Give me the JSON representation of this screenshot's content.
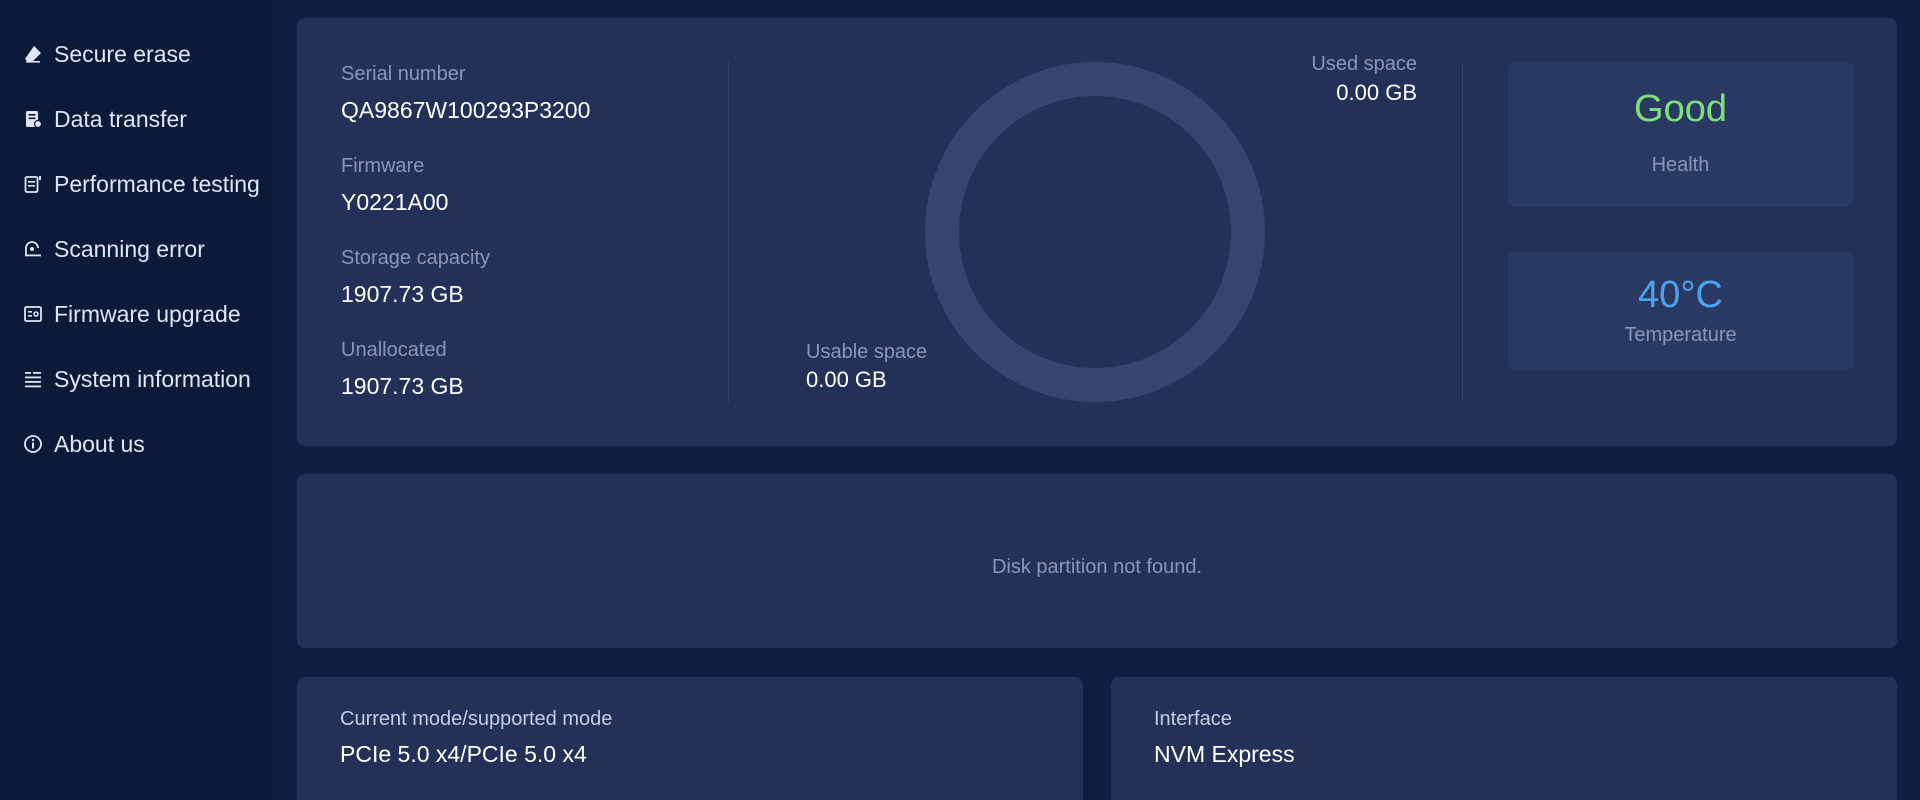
{
  "sidebar": {
    "items": [
      {
        "label": "Secure erase",
        "icon": "eraser-icon"
      },
      {
        "label": "Data transfer",
        "icon": "document-transfer-icon"
      },
      {
        "label": "Performance testing",
        "icon": "performance-doc-icon"
      },
      {
        "label": "Scanning error",
        "icon": "scan-icon"
      },
      {
        "label": "Firmware upgrade",
        "icon": "firmware-chip-icon"
      },
      {
        "label": "System information",
        "icon": "list-icon"
      },
      {
        "label": "About us",
        "icon": "info-icon"
      }
    ]
  },
  "drive_info": {
    "serial_label": "Serial number",
    "serial_value": "QA9867W100293P3200",
    "firmware_label": "Firmware",
    "firmware_value": "Y0221A00",
    "capacity_label": "Storage capacity",
    "capacity_value": "1907.73 GB",
    "unallocated_label": "Unallocated",
    "unallocated_value": "1907.73 GB"
  },
  "space": {
    "used_label": "Used space",
    "used_value": "0.00 GB",
    "usable_label": "Usable space",
    "usable_value": "0.00 GB",
    "used_fraction": 0
  },
  "health": {
    "value": "Good",
    "label": "Health",
    "color": "#7ee07a"
  },
  "temperature": {
    "value": "40°C",
    "label": "Temperature",
    "color": "#4aa3f0"
  },
  "partition": {
    "message": "Disk partition not found."
  },
  "mode": {
    "label": "Current mode/supported mode",
    "value": "PCIe 5.0 x4/PCIe 5.0 x4"
  },
  "interface": {
    "label": "Interface",
    "value": "NVM Express"
  },
  "colors": {
    "sidebar_bg": "#0c1a3a",
    "card_bg": "#233159",
    "ring": "#36446f"
  }
}
